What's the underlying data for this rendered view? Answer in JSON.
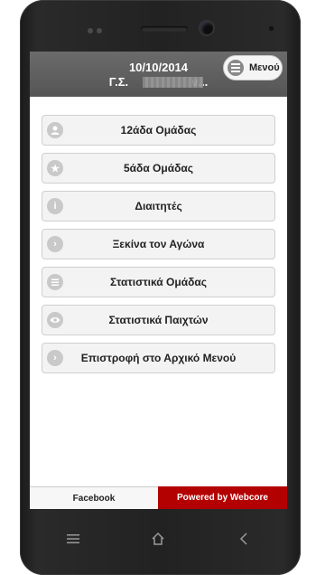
{
  "header": {
    "date": "10/10/2014",
    "club": "Γ.Σ.",
    "club_suffix": "ν...",
    "menu_label": "Μενού"
  },
  "menu_items": [
    {
      "label": "12άδα Ομάδας",
      "icon": "user-icon"
    },
    {
      "label": "5άδα Ομάδας",
      "icon": "star-icon"
    },
    {
      "label": "Διαιτητές",
      "icon": "info-icon"
    },
    {
      "label": "Ξεκίνα τον Αγώνα",
      "icon": "chevron-right-icon"
    },
    {
      "label": "Στατιστικά Ομάδας",
      "icon": "list-icon"
    },
    {
      "label": "Στατιστικά Παιχτών",
      "icon": "eye-icon"
    },
    {
      "label": "Επιστροφή στο Αρχικό Μενού",
      "icon": "chevron-right-icon"
    }
  ],
  "footer": {
    "facebook_label": "Facebook",
    "powered_label": "Powered by Webcore"
  },
  "colors": {
    "header_bg": "#5e5e5e",
    "accent_red": "#b30000",
    "item_bg": "#f3f3f3"
  }
}
